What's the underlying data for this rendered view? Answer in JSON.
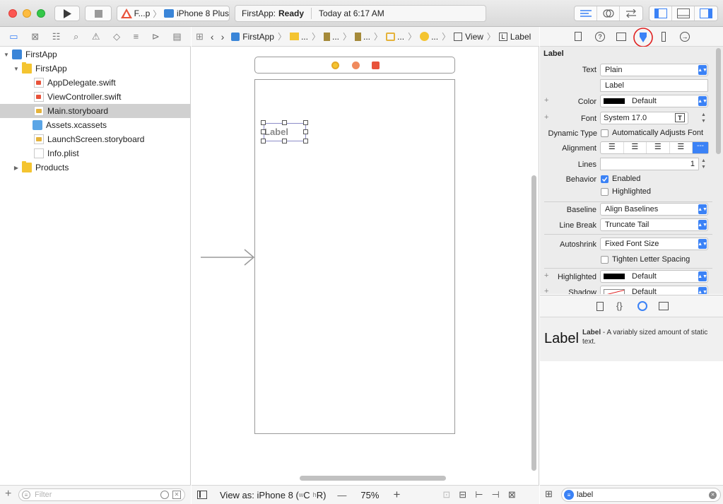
{
  "toolbar": {
    "scheme_name": "F...p",
    "device": "iPhone 8 Plus",
    "status_app": "FirstApp:",
    "status_state": "Ready",
    "status_time": "Today at 6:17 AM"
  },
  "navigator": {
    "items": [
      {
        "label": "FirstApp"
      },
      {
        "label": "FirstApp"
      },
      {
        "label": "AppDelegate.swift"
      },
      {
        "label": "ViewController.swift"
      },
      {
        "label": "Main.storyboard"
      },
      {
        "label": "Assets.xcassets"
      },
      {
        "label": "LaunchScreen.storyboard"
      },
      {
        "label": "Info.plist"
      },
      {
        "label": "Products"
      }
    ],
    "filter_placeholder": "Filter"
  },
  "jumpbar": {
    "project": "FirstApp",
    "ellipsis": "...",
    "view": "View",
    "label": "Label"
  },
  "canvas": {
    "label_text": "Label",
    "view_as": "View as: iPhone 8 (",
    "size_w": "w",
    "size_C1": "C",
    "size_h": "h",
    "size_R": "R)",
    "zoom_minus": "—",
    "zoom": "75%",
    "zoom_plus": "+"
  },
  "inspector": {
    "section": "Label",
    "text_label": "Text",
    "text_value": "Plain",
    "text_field": "Label",
    "color_label": "Color",
    "color_value": "Default",
    "font_label": "Font",
    "font_value": "System 17.0",
    "dynamic_label": "Dynamic Type",
    "dynamic_value": "Automatically Adjusts Font",
    "alignment_label": "Alignment",
    "lines_label": "Lines",
    "lines_value": "1",
    "behavior_label": "Behavior",
    "enabled": "Enabled",
    "highlighted_cb": "Highlighted",
    "baseline_label": "Baseline",
    "baseline_value": "Align Baselines",
    "linebreak_label": "Line Break",
    "linebreak_value": "Truncate Tail",
    "autoshrink_label": "Autoshrink",
    "autoshrink_value": "Fixed Font Size",
    "tighten": "Tighten Letter Spacing",
    "highlighted_label": "Highlighted",
    "highlighted_value": "Default",
    "shadow_label": "Shadow",
    "shadow_value": "Default"
  },
  "library": {
    "item_big": "Label",
    "item_title": "Label",
    "item_desc": " - A variably sized amount of static text.",
    "filter_value": "label"
  },
  "colors": {
    "accent": "#3b82f6",
    "annotation_circle": "#e02020"
  }
}
